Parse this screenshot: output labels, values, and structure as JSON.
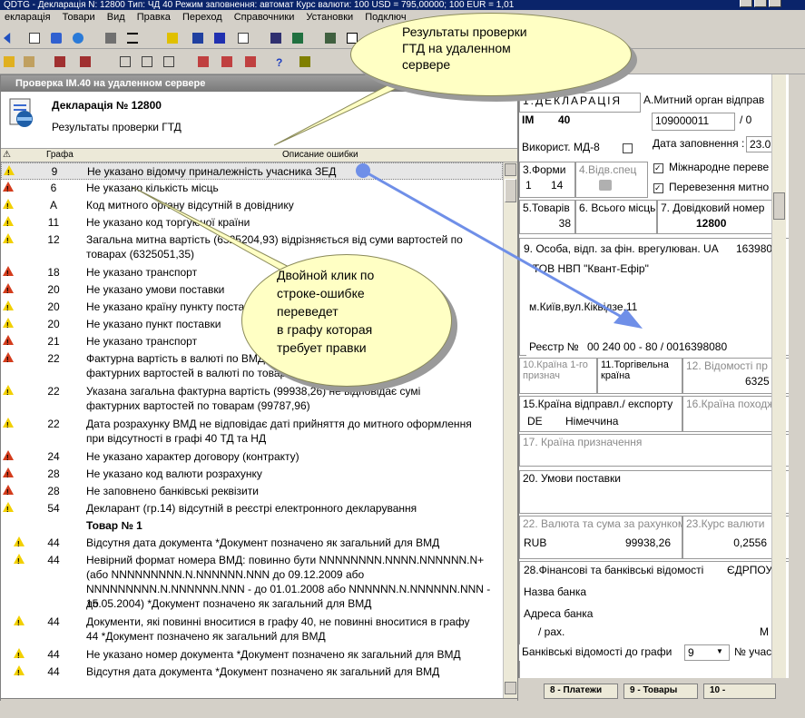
{
  "app": {
    "title": "QDTG - Декларація N: 12800 Тип: ЧД 40  Режим заповнення: автомат  Курс валюти: 100 USD = 795,00000; 100 EUR = 1,01",
    "menu": [
      "екларація",
      "Товари",
      "Вид",
      "Правка",
      "Переход",
      "Справочники",
      "Установки",
      "Подключ"
    ]
  },
  "callouts": {
    "top": [
      "Результаты проверки",
      "ГТД на удаленном",
      "сервере"
    ],
    "middle": [
      "Двойной клик по",
      "строке-ошибке",
      "переведет",
      "в графу которая",
      "требует правки"
    ]
  },
  "dialog": {
    "title": "Проверка IM.40 на удаленном сервере",
    "decl_title": "Декларація № 12800",
    "subtitle": "Результаты проверки ГТД",
    "col_graph": "Графа",
    "col_desc": "Описание ошибки"
  },
  "errors": [
    {
      "level": "warn",
      "graph": "9",
      "desc": [
        "Не указано відомчу приналежність учасника ЗЕД"
      ]
    },
    {
      "level": "error",
      "graph": "6",
      "desc": [
        "Не указано кількість місць"
      ]
    },
    {
      "level": "warn",
      "graph": "А",
      "desc": [
        "Код митного органу відсутній в довіднику"
      ]
    },
    {
      "level": "warn",
      "graph": "11",
      "desc": [
        "Не указано код торгуючої країни"
      ]
    },
    {
      "level": "warn",
      "graph": "12",
      "desc": [
        "Загальна митна вартість (6325204,93) відрізняється від суми вартостей по",
        "товарах (6325051,35)"
      ]
    },
    {
      "level": "error",
      "graph": "18",
      "desc": [
        "Не указано транспорт"
      ]
    },
    {
      "level": "error",
      "graph": "20",
      "desc": [
        "Не указано умови поставки"
      ]
    },
    {
      "level": "warn",
      "graph": "20",
      "desc": [
        "Не указано країну пункту поставки"
      ]
    },
    {
      "level": "warn",
      "graph": "20",
      "desc": [
        "Не указано пункт поставки"
      ]
    },
    {
      "level": "error",
      "graph": "21",
      "desc": [
        "Не указано транспорт"
      ]
    },
    {
      "level": "error",
      "graph": "22",
      "desc": [
        "Фактурна вартість в валюті по ВМД відрізняється від суми",
        "фактурних вартостей в валюті по товарах"
      ]
    },
    {
      "level": "warn",
      "graph": "22",
      "desc": [
        "Указана загальна фактурна вартість (99938,26) не відповідає сумі",
        "фактурних вартостей по товарам (99787,96)"
      ]
    },
    {
      "level": "warn",
      "graph": "22",
      "desc": [
        "Дата розрахунку ВМД не відповідає даті прийняття до митного оформлення",
        "при відсутності в графі 40 ТД та НД"
      ]
    },
    {
      "level": "error",
      "graph": "24",
      "desc": [
        "Не указано характер договору (контракту)"
      ]
    },
    {
      "level": "error",
      "graph": "28",
      "desc": [
        "Не указано код валюти розрахунку"
      ]
    },
    {
      "level": "error",
      "graph": "28",
      "desc": [
        "Не заповнено банківські реквізити"
      ]
    },
    {
      "level": "warn",
      "graph": "54",
      "desc": [
        "Декларант (гр.14) відсутній в реєстрі електронного декларування"
      ]
    },
    {
      "level": "group",
      "graph": "",
      "desc": [
        "Товар № 1"
      ]
    },
    {
      "level": "warn",
      "graph": "44",
      "desc": [
        "Відсутня дата документа *Документ позначено як загальний для ВМД"
      ]
    },
    {
      "level": "warn",
      "graph": "44",
      "desc": [
        "Невірний формат номера ВМД: повинно бути NNNNNNNN.NNNN.NNNNNN.N+",
        "(або NNNNNNNNN.N.NNNNNN.NNN до 09.12.2009 або",
        "NNNNNNNNN.N.NNNNNN.NNN - до 01.01.2008 або NNNNNN.N.NNNNNN.NNN - до",
        "15.05.2004) *Документ позначено як загальний для ВМД"
      ]
    },
    {
      "level": "warn",
      "graph": "44",
      "desc": [
        "Документи, які повинні вноситися в графу 40, не повинні вноситися в графу",
        "44 *Документ позначено як загальний для ВМД"
      ]
    },
    {
      "level": "warn",
      "graph": "44",
      "desc": [
        "Не указано номер документа *Документ позначено як загальний для ВМД"
      ]
    },
    {
      "level": "warn",
      "graph": "44",
      "desc": [
        "Відсутня дата документа *Документ позначено як загальний для ВМД"
      ]
    }
  ],
  "form": {
    "decl_header": "1.ДЕКЛАРАЦІЯ",
    "im": "ІМ",
    "im_code": "40",
    "md8": "Використ. МД-8",
    "customs_label": "А.Митний орган відправ",
    "customs_code": "109000011",
    "customs_sep": "/ 0",
    "fill_date_label": "Дата заповнення :",
    "fill_date": "23.0",
    "intl_transport": "Міжнародне переве",
    "transport_mit": "Перевезення митно",
    "f3_label": "3.Форми",
    "f3_a": "1",
    "f3_b": "14",
    "f4_label": "4.Відв.спец",
    "f5_label": "5.Товарів",
    "f5_val": "38",
    "f6_label": "6. Всього місць",
    "f7_label": "7. Довідковий номер",
    "f7_val": "12800",
    "f9_label": "9. Особа, відп. за фін. врегулюван. UA",
    "f9_code": "163980",
    "f9_name": "ТОВ НВП \"Квант-Ефір\"",
    "f9_addr": "м.Київ,вул.Кіквідзе,11",
    "reg_label": "Реєстр №",
    "reg_val": "00   240    00 - 80  / 0016398080",
    "f10_label": "10.Країна 1-го признач",
    "f11_label": "11.Торгівельна країна",
    "f12_label": "12. Відомості пр",
    "f12_val": "6325",
    "f15_label": "15.Країна відправл./ експорту",
    "f15_code": "DE",
    "f15_name": "Німеччина",
    "f16_label": "16.Країна походж",
    "f17_label": "17. Країна призначення",
    "f20_label": "20. Умови поставки",
    "f22_label": "22. Валюта та сума за рахунком",
    "f22_cur": "RUB",
    "f22_sum": "99938,26",
    "f23_label": "23.Курс валюти",
    "f23_val": "0,2556",
    "f28_label": "28.Фінансові та банківські відомості",
    "edrpou": "ЄДРПОУ",
    "bank_name": "Назва банка",
    "bank_addr": "Адреса банка",
    "account": "/ рах.",
    "m_label": "М",
    "bank_info": "Банківські відомості  до графи",
    "bank_graph": "9",
    "participant": "№ учас"
  },
  "tabs": [
    "8 - Платежи",
    "9 - Товары",
    "10 -"
  ]
}
